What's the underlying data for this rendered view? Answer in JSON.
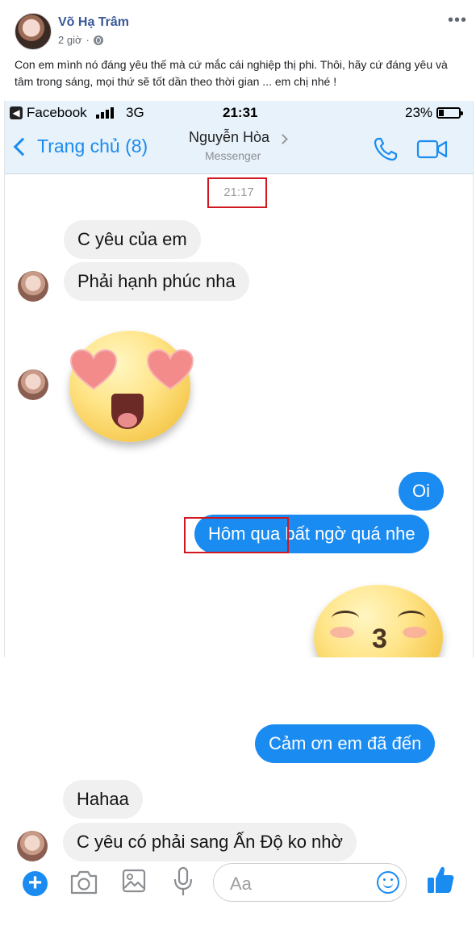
{
  "post": {
    "author": "Võ Hạ Trâm",
    "time": "2 giờ",
    "more_label": "•••",
    "caption": "Con em mình nó đáng yêu thế mà cứ mắc cái nghiệp thị phi. Thôi, hãy cứ đáng yêu và tâm trong sáng, mọi thứ sẽ tốt dần theo thời gian ... em chị nhé !"
  },
  "statusbar": {
    "app": "Facebook",
    "network": "3G",
    "time": "21:31",
    "battery": "23%",
    "battery_level": 0.23
  },
  "navbar": {
    "back_label": "Trang chủ (8)",
    "contact_name": "Nguyễn Hòa",
    "contact_sub": "Messenger"
  },
  "chat": {
    "timestamp": "21:17",
    "messages": [
      {
        "text": "C yêu của em"
      },
      {
        "text": "Phải hạnh phúc nha"
      },
      {
        "text": "Oi"
      },
      {
        "text": "Hôm qua bất ngờ quá nhe"
      },
      {
        "text": "Cảm ơn em đã đến"
      },
      {
        "text": "Hahaa"
      },
      {
        "text": "C yêu có phải sang Ấn Độ ko nhờ"
      }
    ]
  },
  "composer": {
    "placeholder": "Aa"
  },
  "colors": {
    "accent": "#1a8bf0",
    "highlight": "#d0171f"
  }
}
